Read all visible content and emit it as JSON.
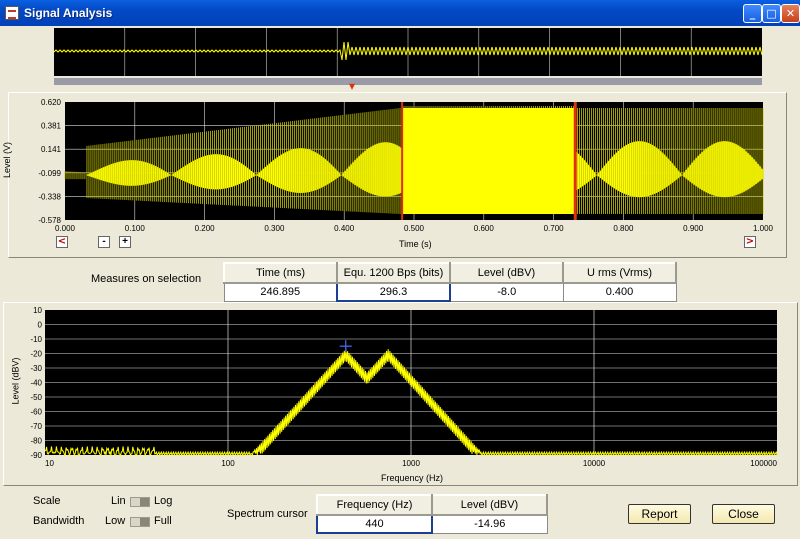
{
  "window": {
    "title": "Signal Analysis",
    "min": "_",
    "max": "□",
    "close": "✕"
  },
  "overview": {
    "markers": [
      "▾"
    ]
  },
  "waveform": {
    "ylabel": "Level (V)",
    "xlabel": "Time (s)",
    "y_ticks": [
      "0.620",
      "0.381",
      "0.141",
      "-0.099",
      "-0.338",
      "-0.578"
    ],
    "x_ticks": [
      "0.000",
      "0.100",
      "0.200",
      "0.300",
      "0.400",
      "0.500",
      "0.600",
      "0.700",
      "0.800",
      "0.900",
      "1.000"
    ],
    "selection": [
      0.483,
      0.731
    ],
    "nav": {
      "left": "<",
      "minus": "-",
      "plus": "+",
      "right": ">"
    },
    "colors": {
      "bg": "#000000",
      "trace": "#FFFF00",
      "marker": "#E03010"
    }
  },
  "measures": {
    "label": "Measures on selection",
    "headers": [
      "Time (ms)",
      "Equ. 1200 Bps (bits)",
      "Level (dBV)",
      "U rms (Vrms)"
    ],
    "values": [
      "246.895",
      "296.3",
      "-8.0",
      "0.400"
    ]
  },
  "spectrum": {
    "ylabel": "Level (dBV)",
    "xlabel": "Frequency (Hz)",
    "y_ticks": [
      "10",
      "0",
      "-10",
      "-20",
      "-30",
      "-40",
      "-50",
      "-60",
      "-70",
      "-80",
      "-90"
    ],
    "x_ticks": [
      "10",
      "100",
      "1000",
      "10000",
      "100000"
    ],
    "cursor": {
      "freq": 440,
      "level": -14.96
    },
    "peaks": [
      440,
      750
    ]
  },
  "bottom": {
    "scale_label": "Scale",
    "scale_lin": "Lin",
    "scale_log": "Log",
    "bandwidth_label": "Bandwidth",
    "bw_low": "Low",
    "bw_full": "Full",
    "cursor_label": "Spectrum cursor",
    "cursor_headers": [
      "Frequency (Hz)",
      "Level (dBV)"
    ],
    "cursor_values": [
      "440",
      "-14.96"
    ],
    "report_button": "Report",
    "close_button": "Close"
  }
}
